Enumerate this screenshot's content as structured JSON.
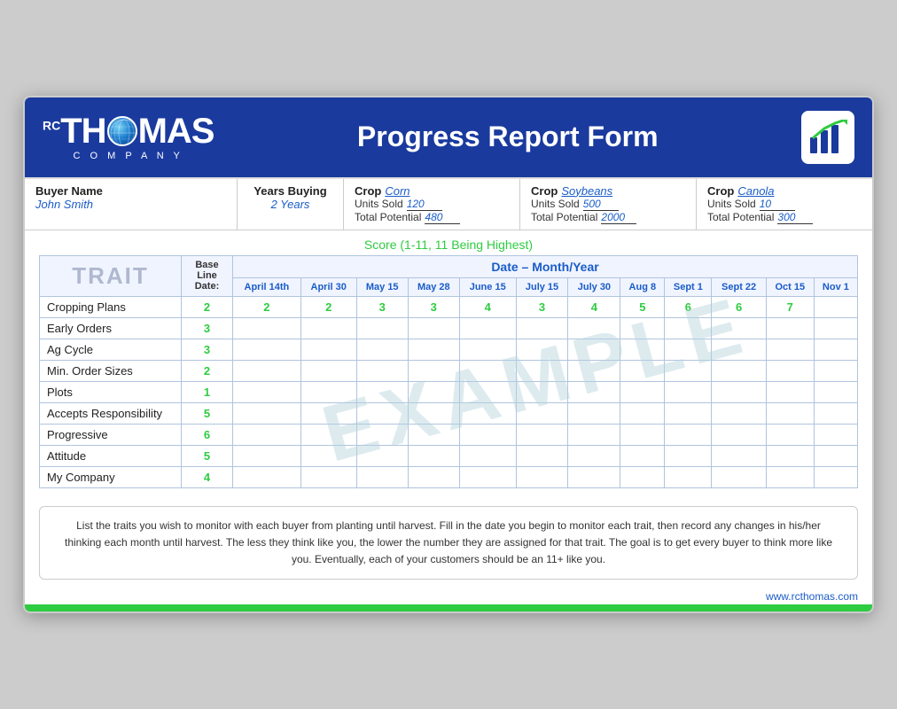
{
  "header": {
    "title": "Progress Report Form",
    "logo_rc": "RC",
    "logo_name": "THOMAS",
    "logo_company": "C O M P A N Y"
  },
  "info_bar": {
    "buyer_name_label": "Buyer Name",
    "buyer_name_value": "John Smith",
    "years_buying_label": "Years Buying",
    "years_buying_value": "2 Years",
    "crops": [
      {
        "label": "Crop",
        "name": "Corn",
        "units_sold_label": "Units Sold",
        "units_sold_value": "120",
        "total_potential_label": "Total Potential",
        "total_potential_value": "480"
      },
      {
        "label": "Crop",
        "name": "Soybeans",
        "units_sold_label": "Units Sold",
        "units_sold_value": "500",
        "total_potential_label": "Total Potential",
        "total_potential_value": "2000"
      },
      {
        "label": "Crop",
        "name": "Canola",
        "units_sold_label": "Units Sold",
        "units_sold_value": "10",
        "total_potential_label": "Total Potential",
        "total_potential_value": "300"
      }
    ]
  },
  "score_label": "Score (1-11, 11 Being Highest)",
  "table": {
    "trait_header": "TRAIT",
    "baseline_header": "Base Line Date:",
    "date_header": "Date – Month/Year",
    "date_columns": [
      "April 14th",
      "April 30",
      "May 15",
      "May 28",
      "June 15",
      "July 15",
      "July 30",
      "Aug 8",
      "Sept 1",
      "Sept 22",
      "Oct 15",
      "Nov 1"
    ],
    "traits": [
      {
        "name": "Cropping Plans",
        "baseline": "2",
        "scores": [
          "2",
          "2",
          "3",
          "3",
          "4",
          "3",
          "4",
          "5",
          "6",
          "6",
          "7"
        ]
      },
      {
        "name": "Early Orders",
        "baseline": "3",
        "scores": []
      },
      {
        "name": "Ag Cycle",
        "baseline": "3",
        "scores": []
      },
      {
        "name": "Min. Order Sizes",
        "baseline": "2",
        "scores": []
      },
      {
        "name": "Plots",
        "baseline": "1",
        "scores": []
      },
      {
        "name": "Accepts Responsibility",
        "baseline": "5",
        "scores": []
      },
      {
        "name": "Progressive",
        "baseline": "6",
        "scores": []
      },
      {
        "name": "Attitude",
        "baseline": "5",
        "scores": []
      },
      {
        "name": "My Company",
        "baseline": "4",
        "scores": []
      }
    ]
  },
  "example_watermark": "EXAMPLE",
  "footer_note": "List the traits you wish to monitor with each buyer from planting until harvest.  Fill in the date you begin to monitor each trait, then record any changes in his/her thinking each month until harvest.  The less they think like you, the lower the number they are assigned for that trait.  The goal is to get every buyer to think more like you.  Eventually, each of your customers should be an 11+ like you.",
  "website": "www.rcthomas.com"
}
